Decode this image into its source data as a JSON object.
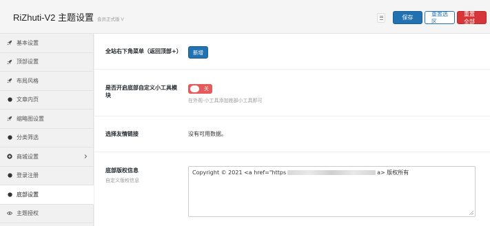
{
  "header": {
    "title": "RiZhuti-V2 主题设置",
    "subtitle": "会员正式版 V",
    "save_label": "保存",
    "reset_section_label": "重置选区",
    "reset_all_label": "重置全部"
  },
  "sidebar": {
    "items": [
      {
        "label": "基本设置",
        "icon": "rocket-icon"
      },
      {
        "label": "顶部设置",
        "icon": "rocket-icon"
      },
      {
        "label": "布局风格",
        "icon": "rocket-icon"
      },
      {
        "label": "文章内页",
        "icon": "circle-icon"
      },
      {
        "label": "缩略图设置",
        "icon": "rocket-icon"
      },
      {
        "label": "分类筛选",
        "icon": "circle-icon"
      },
      {
        "label": "商城设置",
        "icon": "plus-circle-icon"
      },
      {
        "label": "登录注册",
        "icon": "circle-icon"
      },
      {
        "label": "底部设置",
        "icon": "circle-icon"
      },
      {
        "label": "主题授权",
        "icon": "eye-icon"
      }
    ],
    "active_index": 8
  },
  "main": {
    "fields": {
      "corner_menu": {
        "label": "全站右下角菜单（返回顶部+）",
        "button_label": "新增"
      },
      "footer_widget": {
        "label": "是否开启底部自定义小工具模块",
        "toggle_text": "关",
        "help": "在外观-小工具添加底部小工具即可"
      },
      "friend_links": {
        "label": "选择友情链接",
        "value": "没有可用数据。"
      },
      "copyright": {
        "label": "底部版权信息",
        "sublabel": "自定义版权信息",
        "value_prefix": "Copyright © 2021 <a href=\"https",
        "value_suffix": "a> 版权所有"
      }
    }
  },
  "colors": {
    "primary": "#2271b1",
    "danger": "#d63638",
    "toggle_off": "#e55a5a"
  }
}
